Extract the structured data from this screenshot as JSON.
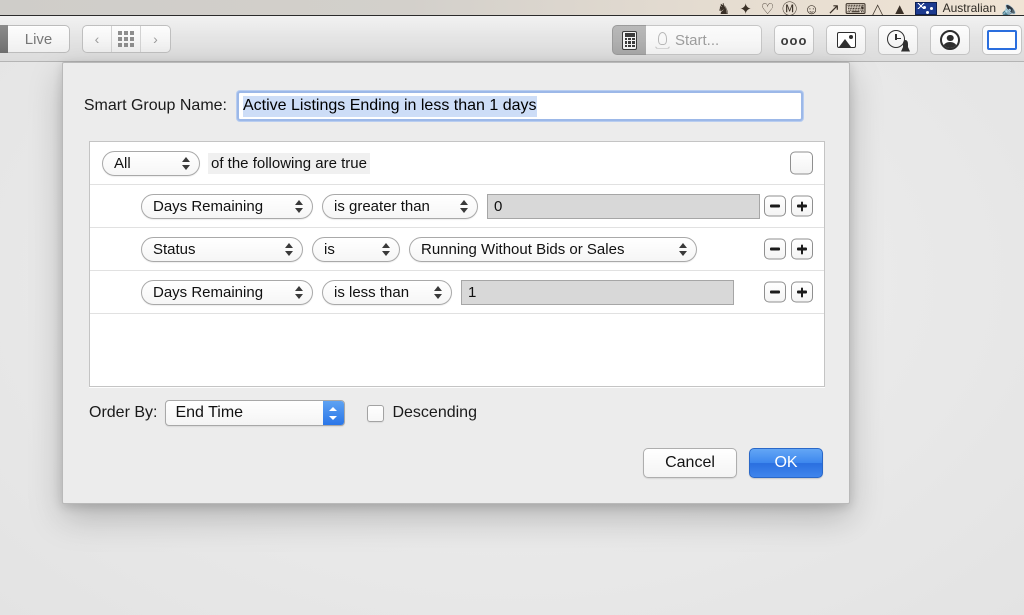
{
  "menubar": {
    "icons": [
      "bluetooth-icon",
      "diamond-icon",
      "heart-icon",
      "circle-a-icon",
      "smiley-icon",
      "wifi-off-icon",
      "keyboard-icon",
      "wifi-icon",
      "volume-triangle-icon",
      "flag-icon"
    ],
    "input_source": "Australian",
    "speaker_icon": "speaker-icon"
  },
  "toolbar": {
    "live_label": "Live",
    "nav_back_icon": "chevron-left-icon",
    "nav_grid_icon": "grid-icon",
    "nav_forward_icon": "chevron-right-icon",
    "calculator_icon": "calculator-icon",
    "start_icon": "rocket-icon",
    "start_placeholder": "Start...",
    "more_label": "ooo",
    "image_icon": "image-icon",
    "history_icon": "clock-rocket-icon",
    "account_icon": "person-icon",
    "window_icon": "blue-square-icon"
  },
  "dialog": {
    "name_label": "Smart Group Name:",
    "name_value": "Active Listings Ending in less than 1 days",
    "match": {
      "selected": "All",
      "suffix_label": "of the following are true",
      "add_icon": "plus-icon"
    },
    "rules": [
      {
        "field": "Days Remaining",
        "operator": "is greater than",
        "value": "0",
        "value_kind": "text",
        "remove_icon": "minus-icon",
        "add_icon": "plus-icon"
      },
      {
        "field": "Status",
        "operator": "is",
        "value": "Running Without Bids or Sales",
        "value_kind": "popup",
        "remove_icon": "minus-icon",
        "add_icon": "plus-icon"
      },
      {
        "field": "Days Remaining",
        "operator": "is less than",
        "value": "1",
        "value_kind": "text",
        "remove_icon": "minus-icon",
        "add_icon": "plus-icon"
      }
    ],
    "order_by": {
      "label": "Order By:",
      "selected": "End Time",
      "descending_label": "Descending",
      "descending_checked": false
    },
    "cancel_label": "Cancel",
    "ok_label": "OK"
  },
  "colors": {
    "accent_blue": "#3d87ee",
    "selection_blue": "#cdddf7",
    "focus_ring": "#9cb8e8",
    "dialog_bg": "#ececec",
    "field_gray": "#d8d8d8"
  }
}
